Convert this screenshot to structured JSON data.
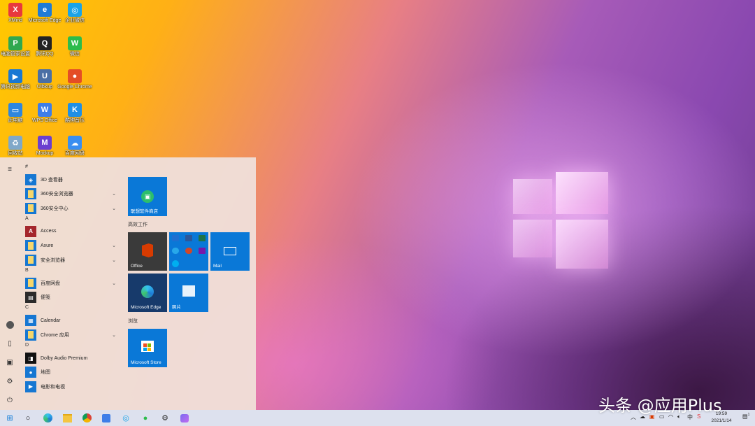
{
  "desktop": {
    "icons": [
      {
        "label": "XMind",
        "icon": "xmind-icon",
        "color": "#e8383d",
        "glyph": "X"
      },
      {
        "label": "Microsoft Edge",
        "icon": "edge-icon",
        "color": "#1f7bd6",
        "glyph": "e"
      },
      {
        "label": "企业微信",
        "icon": "wecom-icon",
        "color": "#1aa3e8",
        "glyph": "◎"
      },
      {
        "label": "电脑管家设置",
        "icon": "pc-manager-icon",
        "color": "#2fa84f",
        "glyph": "P"
      },
      {
        "label": "腾讯QQ",
        "icon": "qq-icon",
        "color": "#222222",
        "glyph": "Q"
      },
      {
        "label": "微信",
        "icon": "wechat-icon",
        "color": "#2dbc4b",
        "glyph": "W"
      },
      {
        "label": "腾讯视频电脑",
        "icon": "video-icon",
        "color": "#1a78d3",
        "glyph": "▶"
      },
      {
        "label": "UIbkup",
        "icon": "uibkup-icon",
        "color": "#4a6fa5",
        "glyph": "U"
      },
      {
        "label": "Google Chrome",
        "icon": "chrome-icon",
        "color": "#e44d26",
        "glyph": "●"
      },
      {
        "label": "此电脑",
        "icon": "this-pc-icon",
        "color": "#2e86de",
        "glyph": "▭"
      },
      {
        "label": "WPS Office",
        "icon": "wps-icon",
        "color": "#3e7ee8",
        "glyph": "W"
      },
      {
        "label": "酷狗音乐",
        "icon": "kugou-icon",
        "color": "#1f8fe5",
        "glyph": "K"
      },
      {
        "label": "回收站",
        "icon": "recycle-bin-icon",
        "color": "#7fa8c9",
        "glyph": "♻"
      },
      {
        "label": "Mockup",
        "icon": "mockup-icon",
        "color": "#6b3fd0",
        "glyph": "M"
      },
      {
        "label": "百度网盘",
        "icon": "baidu-netdisk-icon",
        "color": "#3a8ef0",
        "glyph": "☁"
      }
    ]
  },
  "start_menu": {
    "apps": [
      {
        "type": "letter",
        "text": "#"
      },
      {
        "type": "app",
        "name": "3D 查看器",
        "icon": "3d-viewer-icon",
        "color": "#1677d2",
        "glyph": "◈",
        "chevron": false
      },
      {
        "type": "app",
        "name": "360安全浏览器",
        "icon": "folder-icon",
        "color": "#1677d2",
        "glyph": "▮",
        "chevron": true
      },
      {
        "type": "app",
        "name": "360安全中心",
        "icon": "folder-icon",
        "color": "#1677d2",
        "glyph": "▮",
        "chevron": true
      },
      {
        "type": "letter",
        "text": "A"
      },
      {
        "type": "app",
        "name": "Access",
        "icon": "access-icon",
        "color": "#a4262c",
        "glyph": "A",
        "chevron": false
      },
      {
        "type": "app",
        "name": "Axure",
        "icon": "folder-icon",
        "color": "#1677d2",
        "glyph": "▮",
        "chevron": true
      },
      {
        "type": "app",
        "name": "安全浏览器",
        "icon": "folder-icon",
        "color": "#1677d2",
        "glyph": "▮",
        "chevron": true
      },
      {
        "type": "letter",
        "text": "B"
      },
      {
        "type": "app",
        "name": "百度网盘",
        "icon": "folder-icon",
        "color": "#1677d2",
        "glyph": "▮",
        "chevron": true
      },
      {
        "type": "app",
        "name": "便笺",
        "icon": "sticky-notes-icon",
        "color": "#2b2b2b",
        "glyph": "▤",
        "chevron": false
      },
      {
        "type": "letter",
        "text": "C"
      },
      {
        "type": "app",
        "name": "Calendar",
        "icon": "calendar-icon",
        "color": "#1677d2",
        "glyph": "▦",
        "chevron": false
      },
      {
        "type": "app",
        "name": "Chrome 应用",
        "icon": "folder-icon",
        "color": "#1677d2",
        "glyph": "▮",
        "chevron": true
      },
      {
        "type": "letter",
        "text": "D"
      },
      {
        "type": "app",
        "name": "Dolby Audio Premium",
        "icon": "dolby-icon",
        "color": "#111111",
        "glyph": "◨",
        "chevron": false
      },
      {
        "type": "app",
        "name": "地图",
        "icon": "maps-icon",
        "color": "#1677d2",
        "glyph": "●",
        "chevron": false
      },
      {
        "type": "app",
        "name": "电影和电视",
        "icon": "movies-icon",
        "color": "#1677d2",
        "glyph": "▶",
        "chevron": false
      }
    ],
    "tiles": {
      "store_lenovo": "联想软件商店",
      "group_work": "高效工作",
      "office": "Office",
      "mail": "Mail",
      "edge": "Microsoft Edge",
      "photos": "照片",
      "group_browse": "浏览",
      "store": "Microsoft Store"
    }
  },
  "taskbar": {
    "time": "19:59",
    "date": "2021/1/14",
    "ime": "中",
    "notification_count": "1"
  },
  "watermark": "头条 @应用Plus",
  "colors": {
    "tile_blue": "#0a78d7",
    "tile_dark": "#3a3a3a",
    "edge_tile": "#173a6b",
    "taskbar": "#dde1ee"
  }
}
